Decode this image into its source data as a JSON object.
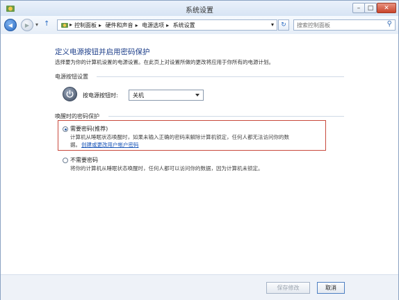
{
  "window": {
    "title": "系统设置",
    "controls": {
      "minimize": "–",
      "maximize": "□",
      "close": "✕"
    }
  },
  "nav": {
    "back_glyph": "◀",
    "forward_glyph": "▶",
    "dropdown_glyph": "▾",
    "up_glyph": "↑",
    "breadcrumb": [
      "控制面板",
      "硬件和声音",
      "电源选项",
      "系统设置"
    ],
    "separator": "▸",
    "refresh_glyph": "↻",
    "search_placeholder": "搜索控制面板",
    "search_glyph": "⚲"
  },
  "page": {
    "heading": "定义电源按钮并启用密码保护",
    "description": "选择要为你的计算机设置的电源设置。在此页上对设置所做的更改将应用于你所有的电源计划。",
    "power_section": {
      "title": "电源按钮设置",
      "label": "按电源按钮时:",
      "selected": "关机"
    },
    "wake_section": {
      "title": "唤醒时的密码保护",
      "options": [
        {
          "title": "需要密码(推荐)",
          "desc_line1": "计算机从睡眠状态唤醒时，如果未输入正确的密码来解除计算机锁定，任何人都无法访问你的数",
          "desc_line2": "据。",
          "link": "创建或更改用户帐户密码",
          "checked": true
        },
        {
          "title": "不需要密码",
          "desc_line1": "将你的计算机从睡眠状态唤醒时，任何人都可以访问你的数据，因为计算机未锁定。",
          "checked": false
        }
      ]
    }
  },
  "footer": {
    "save_label": "保存修改",
    "cancel_label": "取消"
  },
  "colors": {
    "heading": "#1e3f8a",
    "highlight_border": "#c8483c",
    "link": "#1a56b8"
  }
}
